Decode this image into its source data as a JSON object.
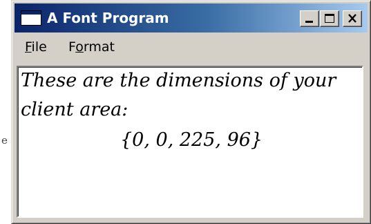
{
  "background": {
    "fragment": "e"
  },
  "window": {
    "title": "A Font Program",
    "controls": {
      "minimize": "_",
      "maximize": "□",
      "close": "×"
    }
  },
  "menu": {
    "file": {
      "mnemonic": "F",
      "rest": "ile"
    },
    "format": {
      "before": "F",
      "mnemonic": "o",
      "rest": "rmat"
    }
  },
  "client": {
    "line1": "These are the dimensions of your",
    "line2": "client area:",
    "line3": "{0, 0, 225, 96}"
  },
  "colors": {
    "titlebar_start": "#0a246a",
    "titlebar_end": "#a6caf0",
    "face": "#d4d0c8",
    "client_bg": "#ffffff"
  }
}
